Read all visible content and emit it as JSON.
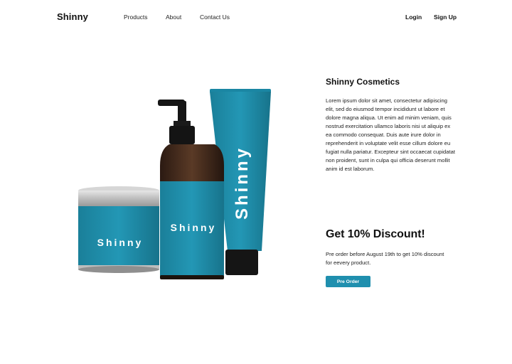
{
  "header": {
    "brand": "Shinny",
    "nav": [
      "Products",
      "About",
      "Contact Us"
    ],
    "login": "Login",
    "signup": "Sign Up"
  },
  "product_image": {
    "jar_label": "Shinny",
    "bottle_label": "Shinny",
    "tube_label": "Shinny",
    "accent_color": "#1f8fae"
  },
  "about": {
    "title": "Shinny Cosmetics",
    "body": "Lorem ipsum dolor sit amet, consectetur adipiscing elit, sed do eiusmod tempor incididunt ut labore et dolore magna aliqua. Ut enim ad minim veniam, quis nostrud exercitation ullamco laboris nisi ut aliquip ex ea commodo consequat. Duis aute irure dolor in reprehenderit in voluptate velit esse cillum dolore eu fugiat nulla pariatur. Excepteur sint occaecat cupidatat non proident, sunt in culpa qui officia deserunt mollit anim id est laborum."
  },
  "discount": {
    "title": "Get 10% Discount!",
    "body": "Pre order before August 19th to get 10% discount for eevery product.",
    "button": "Pre Order"
  }
}
